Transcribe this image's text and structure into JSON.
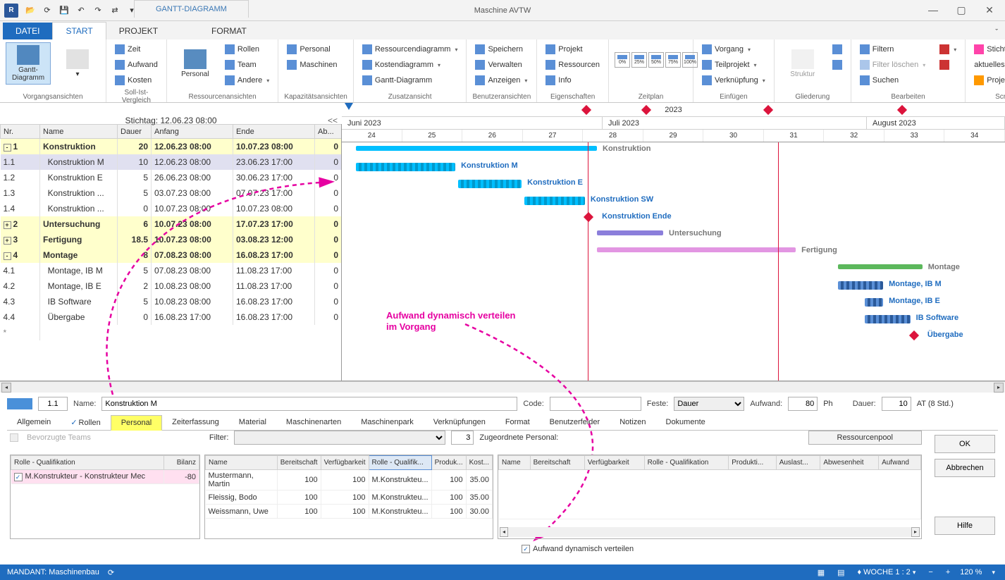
{
  "window": {
    "title": "Maschine AVTW",
    "context_tab": "GANTT-DIAGRAMM"
  },
  "ribbon_tabs": {
    "file": "DATEI",
    "start": "START",
    "projekt": "PROJEKT",
    "format": "FORMAT"
  },
  "ribbon": {
    "vorgang_group": "Vorgangsansichten",
    "gantt_btn": "Gantt-Diagramm",
    "sollist_group": "Soll-Ist-Vergleich",
    "zeit": "Zeit",
    "aufwand": "Aufwand",
    "kosten": "Kosten",
    "ressourcen_group": "Ressourcenansichten",
    "personal_big": "Personal",
    "rollen": "Rollen",
    "team": "Team",
    "andere": "Andere",
    "kapazitaet_group": "Kapazitätsansichten",
    "personal": "Personal",
    "maschinen": "Maschinen",
    "zusatz_group": "Zusatzansicht",
    "ressdiag": "Ressourcendiagramm",
    "kostendiag": "Kostendiagramm",
    "ganttdiag": "Gantt-Diagramm",
    "benutzer_group": "Benutzeransichten",
    "speichern": "Speichern",
    "verwalten": "Verwalten",
    "anzeigen": "Anzeigen",
    "eigenschaften_group": "Eigenschaften",
    "projekt": "Projekt",
    "ressourcen": "Ressourcen",
    "info": "Info",
    "zeitplan_group": "Zeitplan",
    "einfuegen_group": "Einfügen",
    "vorgang": "Vorgang",
    "teilprojekt": "Teilprojekt",
    "verknuepfung": "Verknüpfung",
    "gliederung_group": "Gliederung",
    "struktur": "Struktur",
    "bearbeiten_group": "Bearbeiten",
    "filtern": "Filtern",
    "filter_loeschen": "Filter löschen",
    "suchen": "Suchen",
    "scrollen_group": "Scrollen",
    "stichtag": "Stichtag",
    "aktuelles_datum": "aktuelles Datum",
    "projektanfang": "Projektanfang"
  },
  "stichtag_bar": "Stichtag: 12.06.23 08:00",
  "task_columns": {
    "nr": "Nr.",
    "name": "Name",
    "dauer": "Dauer",
    "anfang": "Anfang",
    "ende": "Ende",
    "ab": "Ab..."
  },
  "tasks": [
    {
      "nr": "1",
      "name": "Konstruktion",
      "dauer": "20",
      "anfang": "12.06.23 08:00",
      "ende": "10.07.23 08:00",
      "ab": "0",
      "sum": true,
      "exp": "-"
    },
    {
      "nr": "1.1",
      "name": "Konstruktion M",
      "dauer": "10",
      "anfang": "12.06.23 08:00",
      "ende": "23.06.23 17:00",
      "ab": "0",
      "sel": true
    },
    {
      "nr": "1.2",
      "name": "Konstruktion E",
      "dauer": "5",
      "anfang": "26.06.23 08:00",
      "ende": "30.06.23 17:00",
      "ab": "0"
    },
    {
      "nr": "1.3",
      "name": "Konstruktion ...",
      "dauer": "5",
      "anfang": "03.07.23 08:00",
      "ende": "07.07.23 17:00",
      "ab": "0"
    },
    {
      "nr": "1.4",
      "name": "Konstruktion ...",
      "dauer": "0",
      "anfang": "10.07.23 08:00",
      "ende": "10.07.23 08:00",
      "ab": "0"
    },
    {
      "nr": "2",
      "name": "Untersuchung",
      "dauer": "6",
      "anfang": "10.07.23 08:00",
      "ende": "17.07.23 17:00",
      "ab": "0",
      "sum": true,
      "exp": "+"
    },
    {
      "nr": "3",
      "name": "Fertigung",
      "dauer": "18.5",
      "anfang": "10.07.23 08:00",
      "ende": "03.08.23 12:00",
      "ab": "0",
      "sum": true,
      "exp": "+"
    },
    {
      "nr": "4",
      "name": "Montage",
      "dauer": "8",
      "anfang": "07.08.23 08:00",
      "ende": "16.08.23 17:00",
      "ab": "0",
      "sum": true,
      "exp": "-"
    },
    {
      "nr": "4.1",
      "name": "Montage, IB M",
      "dauer": "5",
      "anfang": "07.08.23 08:00",
      "ende": "11.08.23 17:00",
      "ab": "0"
    },
    {
      "nr": "4.2",
      "name": "Montage, IB E",
      "dauer": "2",
      "anfang": "10.08.23 08:00",
      "ende": "11.08.23 17:00",
      "ab": "0"
    },
    {
      "nr": "4.3",
      "name": "IB Software",
      "dauer": "5",
      "anfang": "10.08.23 08:00",
      "ende": "16.08.23 17:00",
      "ab": "0"
    },
    {
      "nr": "4.4",
      "name": "Übergabe",
      "dauer": "0",
      "anfang": "16.08.23 17:00",
      "ende": "16.08.23 17:00",
      "ab": "0"
    }
  ],
  "timeline": {
    "year": "2023",
    "months": [
      "Juni 2023",
      "Juli 2023",
      "August 2023"
    ],
    "weeks": [
      "24",
      "25",
      "26",
      "27",
      "28",
      "29",
      "30",
      "31",
      "32",
      "33",
      "34"
    ],
    "labels": {
      "konstruktion": "Konstruktion",
      "konstruktion_m": "Konstruktion M",
      "konstruktion_e": "Konstruktion E",
      "konstruktion_sw": "Konstruktion SW",
      "konstruktion_ende": "Konstruktion Ende",
      "untersuchung": "Untersuchung",
      "fertigung": "Fertigung",
      "montage": "Montage",
      "montage_ib_m": "Montage, IB M",
      "montage_ib_e": "Montage, IB E",
      "ib_software": "IB Software",
      "uebergabe": "Übergabe"
    }
  },
  "annotation": {
    "line1": "Aufwand dynamisch verteilen",
    "line2": "im Vorgang"
  },
  "details": {
    "nr": "1.1",
    "name_label": "Name:",
    "name": "Konstruktion M",
    "code_label": "Code:",
    "code": "",
    "feste_label": "Feste:",
    "feste": "Dauer",
    "aufwand_label": "Aufwand:",
    "aufwand": "80",
    "aufwand_unit": "Ph",
    "dauer_label": "Dauer:",
    "dauer": "10",
    "dauer_unit": "AT (8 Std.)",
    "tabs": [
      "Allgemein",
      "Rollen",
      "Personal",
      "Zeiterfassung",
      "Material",
      "Maschinenarten",
      "Maschinenpark",
      "Verknüpfungen",
      "Format",
      "Benutzerfelder",
      "Notizen",
      "Dokumente"
    ],
    "bevorzugte": "Bevorzugte Teams",
    "filter_label": "Filter:",
    "filter_count": "3",
    "zugeordnet": "Zugeordnete Personal:",
    "ressourcenpool": "Ressourcenpool",
    "role_panel": {
      "cols": [
        "Rolle - Qualifikation",
        "Bilanz"
      ],
      "rows": [
        [
          "M.Konstrukteur - Konstrukteur Mec",
          "-80"
        ]
      ]
    },
    "avail_panel": {
      "cols": [
        "Name",
        "Bereitschaft",
        "Verfügbarkeit",
        "Rolle - Qualifik...",
        "Produk...",
        "Kost..."
      ],
      "rows": [
        [
          "Mustermann, Martin",
          "100",
          "100",
          "M.Konstrukteu...",
          "100",
          "35.00"
        ],
        [
          "Fleissig, Bodo",
          "100",
          "100",
          "M.Konstrukteu...",
          "100",
          "35.00"
        ],
        [
          "Weissmann, Uwe",
          "100",
          "100",
          "M.Konstrukteu...",
          "100",
          "30.00"
        ]
      ]
    },
    "assigned_panel": {
      "cols": [
        "Name",
        "Bereitschaft",
        "Verfügbarkeit",
        "Rolle - Qualifikation",
        "Produkti...",
        "Auslast...",
        "Abwesenheit",
        "Aufwand"
      ]
    },
    "dyn_check": "Aufwand dynamisch verteilen",
    "buttons": {
      "ok": "OK",
      "cancel": "Abbrechen",
      "help": "Hilfe"
    }
  },
  "statusbar": {
    "mandant": "MANDANT: Maschinenbau",
    "woche": "WOCHE 1 : 2",
    "zoom": "120 %"
  }
}
